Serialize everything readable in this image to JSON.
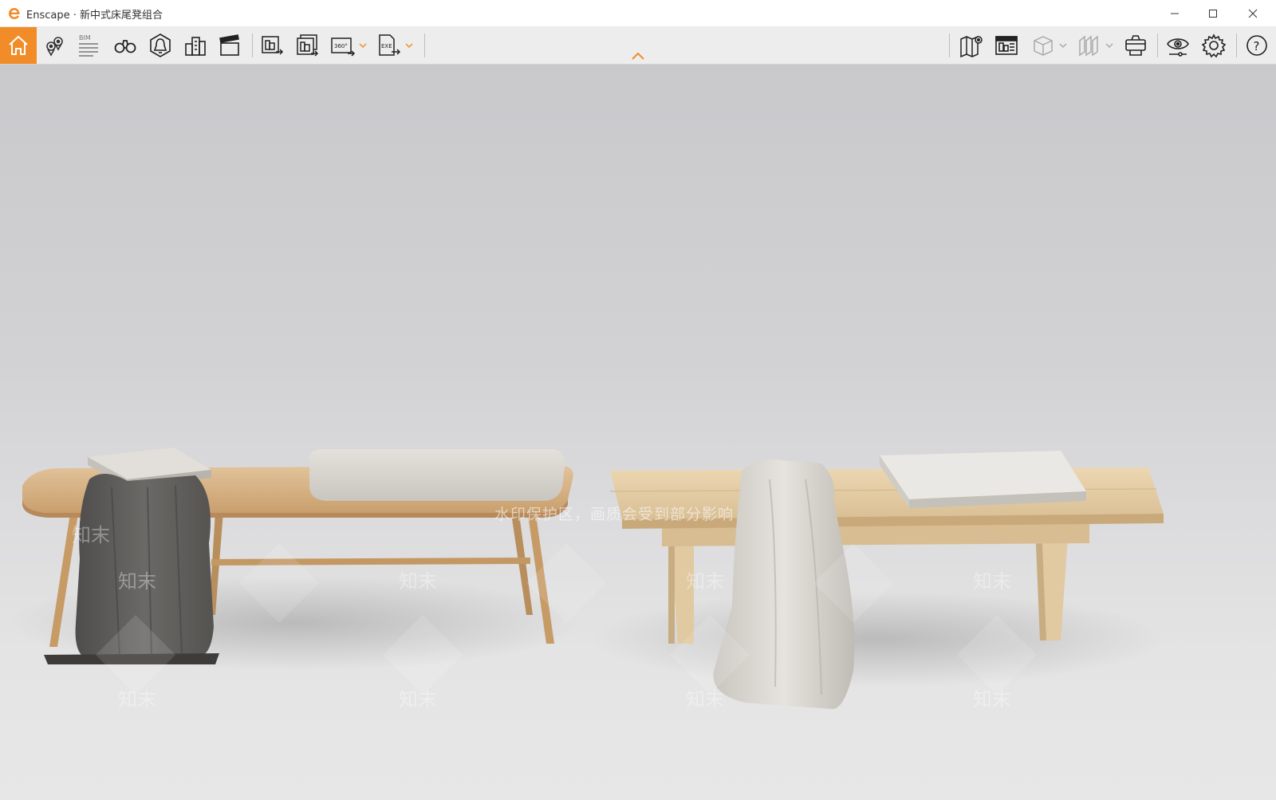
{
  "window": {
    "app_name": "Enscape",
    "separator": "·",
    "document_title": "新中式床尾凳组合"
  },
  "toolbar": {
    "left_items": [
      {
        "name": "home-button",
        "icon": "home-icon",
        "active": true
      },
      {
        "name": "views-button",
        "icon": "location-pins-icon"
      },
      {
        "name": "bim-button",
        "icon": "bim-icon",
        "label": "BIM"
      },
      {
        "name": "walk-mode-button",
        "icon": "binoculars-icon"
      },
      {
        "name": "sun-button",
        "icon": "bell-icon"
      },
      {
        "name": "assets-button",
        "icon": "buildings-icon"
      },
      {
        "name": "video-editor-button",
        "icon": "clapperboard-icon"
      },
      {
        "name": "render-image-button",
        "icon": "render-image-icon"
      },
      {
        "name": "batch-render-button",
        "icon": "batch-render-icon"
      },
      {
        "name": "panorama-button",
        "icon": "panorama-360-icon",
        "label": "360°"
      },
      {
        "name": "export-exe-button",
        "icon": "exe-export-icon",
        "label": "EXE"
      }
    ],
    "right_items": [
      {
        "name": "map-button",
        "icon": "map-pin-icon"
      },
      {
        "name": "settings-panel-button",
        "icon": "panel-icon"
      },
      {
        "name": "cube-button",
        "icon": "cube-icon",
        "disabled": true
      },
      {
        "name": "section-button",
        "icon": "section-icon",
        "disabled": true
      },
      {
        "name": "vr-button",
        "icon": "vr-headset-icon"
      },
      {
        "name": "visual-settings-button",
        "icon": "eye-icon"
      },
      {
        "name": "general-settings-button",
        "icon": "gear-icon"
      },
      {
        "name": "help-button",
        "icon": "help-icon",
        "label": "?"
      }
    ],
    "accent_color": "#f28c28"
  },
  "viewport": {
    "watermark_text": "知末",
    "watermark_notice": "水印保护区，画质会受到部分影响"
  }
}
